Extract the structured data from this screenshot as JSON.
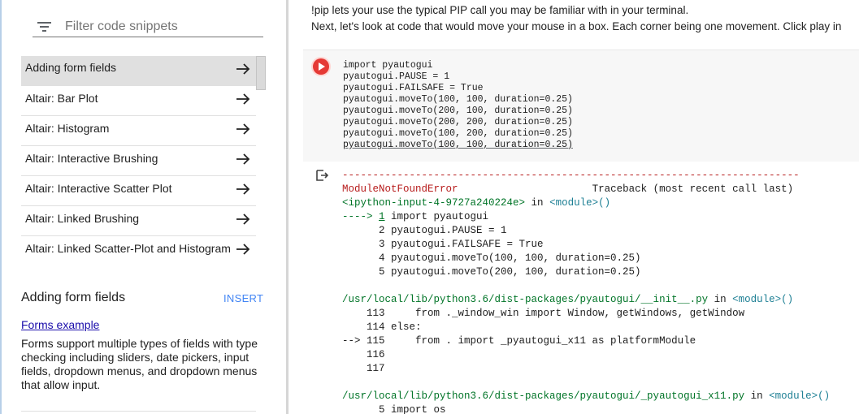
{
  "snippets_panel": {
    "filter_placeholder": "Filter code snippets",
    "items": [
      {
        "label": "Adding form fields",
        "selected": true
      },
      {
        "label": "Altair: Bar Plot",
        "selected": false
      },
      {
        "label": "Altair: Histogram",
        "selected": false
      },
      {
        "label": "Altair: Interactive Brushing",
        "selected": false
      },
      {
        "label": "Altair: Interactive Scatter Plot",
        "selected": false
      },
      {
        "label": "Altair: Linked Brushing",
        "selected": false
      },
      {
        "label": "Altair: Linked Scatter-Plot and Histogram",
        "selected": false
      }
    ],
    "detail": {
      "title": "Adding form fields",
      "insert_label": "INSERT",
      "link_text": "Forms example",
      "description": "Forms support multiple types of fields with type checking including sliders, date pickers, input fields, dropdown menus, and dropdown menus that allow input."
    }
  },
  "notebook": {
    "text_lines": [
      "!pip lets your use the typical PIP call you may be familiar with in your terminal.",
      "Next, let's look at code that would move your mouse in a box. Each corner being one movement. Click play in"
    ],
    "code_cell": {
      "lines": [
        "import pyautogui",
        "pyautogui.PAUSE = 1",
        "pyautogui.FAILSAFE = True",
        "pyautogui.moveTo(100, 100, duration=0.25)",
        "pyautogui.moveTo(200, 100, duration=0.25)",
        "pyautogui.moveTo(200, 200, duration=0.25)",
        "pyautogui.moveTo(100, 200, duration=0.25)",
        "pyautogui.moveTo(100, 100, duration=0.25)"
      ]
    },
    "output": {
      "divider": "---------------------------------------------------------------------------",
      "error_name": "ModuleNotFoundError",
      "traceback_header": "Traceback (most recent call last)",
      "input_ref": "<ipython-input-4-9727a240224e>",
      "in_word": " in ",
      "module_ref": "<module>()",
      "arrow_1": "----> ",
      "link_num": "1",
      "arrow_line_code": " import pyautogui",
      "context_lines": [
        "      2 pyautogui.PAUSE = 1",
        "      3 pyautogui.FAILSAFE = True",
        "      4 pyautogui.moveTo(100, 100, duration=0.25)",
        "      5 pyautogui.moveTo(200, 100, duration=0.25)"
      ],
      "path_1": "/usr/local/lib/python3.6/dist-packages/pyautogui/__init__.py",
      "frame_1_lines": [
        "    113     from ._window_win import Window, getWindows, getWindow",
        "    114 else:",
        "--> 115     from . import _pyautogui_x11 as platformModule",
        "    116",
        "    117"
      ],
      "path_2": "/usr/local/lib/python3.6/dist-packages/pyautogui/_pyautogui_x11.py",
      "frame_2_lines": [
        "      5 import os"
      ]
    }
  },
  "colors": {
    "run_button": "#e53935",
    "link": "#1a0dab",
    "insert": "#4285f4",
    "error": "#b71c1c"
  },
  "icons": [
    "filter-icon",
    "arrow-right-icon",
    "play-icon",
    "output-icon"
  ]
}
